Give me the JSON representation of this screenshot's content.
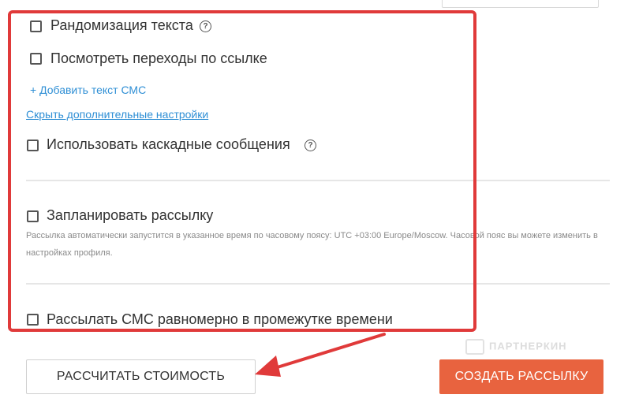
{
  "options": {
    "randomize_text": "Рандомизация текста",
    "view_link_clicks": "Посмотреть переходы по ссылке",
    "add_sms_text": "+ Добавить текст СМС",
    "hide_additional_settings": "Скрыть дополнительные настройки",
    "cascade_messages": "Использовать каскадные сообщения",
    "schedule_mailing": "Запланировать рассылку",
    "schedule_hint": "Рассылка автоматически запустится в указанное время по часовому поясу: UTC +03:00 Europe/Moscow. Часовой пояс вы можете изменить в настройках профиля.",
    "spread_sms": "Рассылать СМС равномерно в промежутке времени"
  },
  "buttons": {
    "calculate_cost": "РАССЧИТАТЬ СТОИМОСТЬ",
    "create_mailing": "СОЗДАТЬ РАССЫЛКУ"
  },
  "help_glyph": "?",
  "watermark": "ПАРТНЕРКИН",
  "colors": {
    "annotation_red": "#e03a3a",
    "primary_button": "#e8633f",
    "link_blue": "#2f8fd5"
  }
}
